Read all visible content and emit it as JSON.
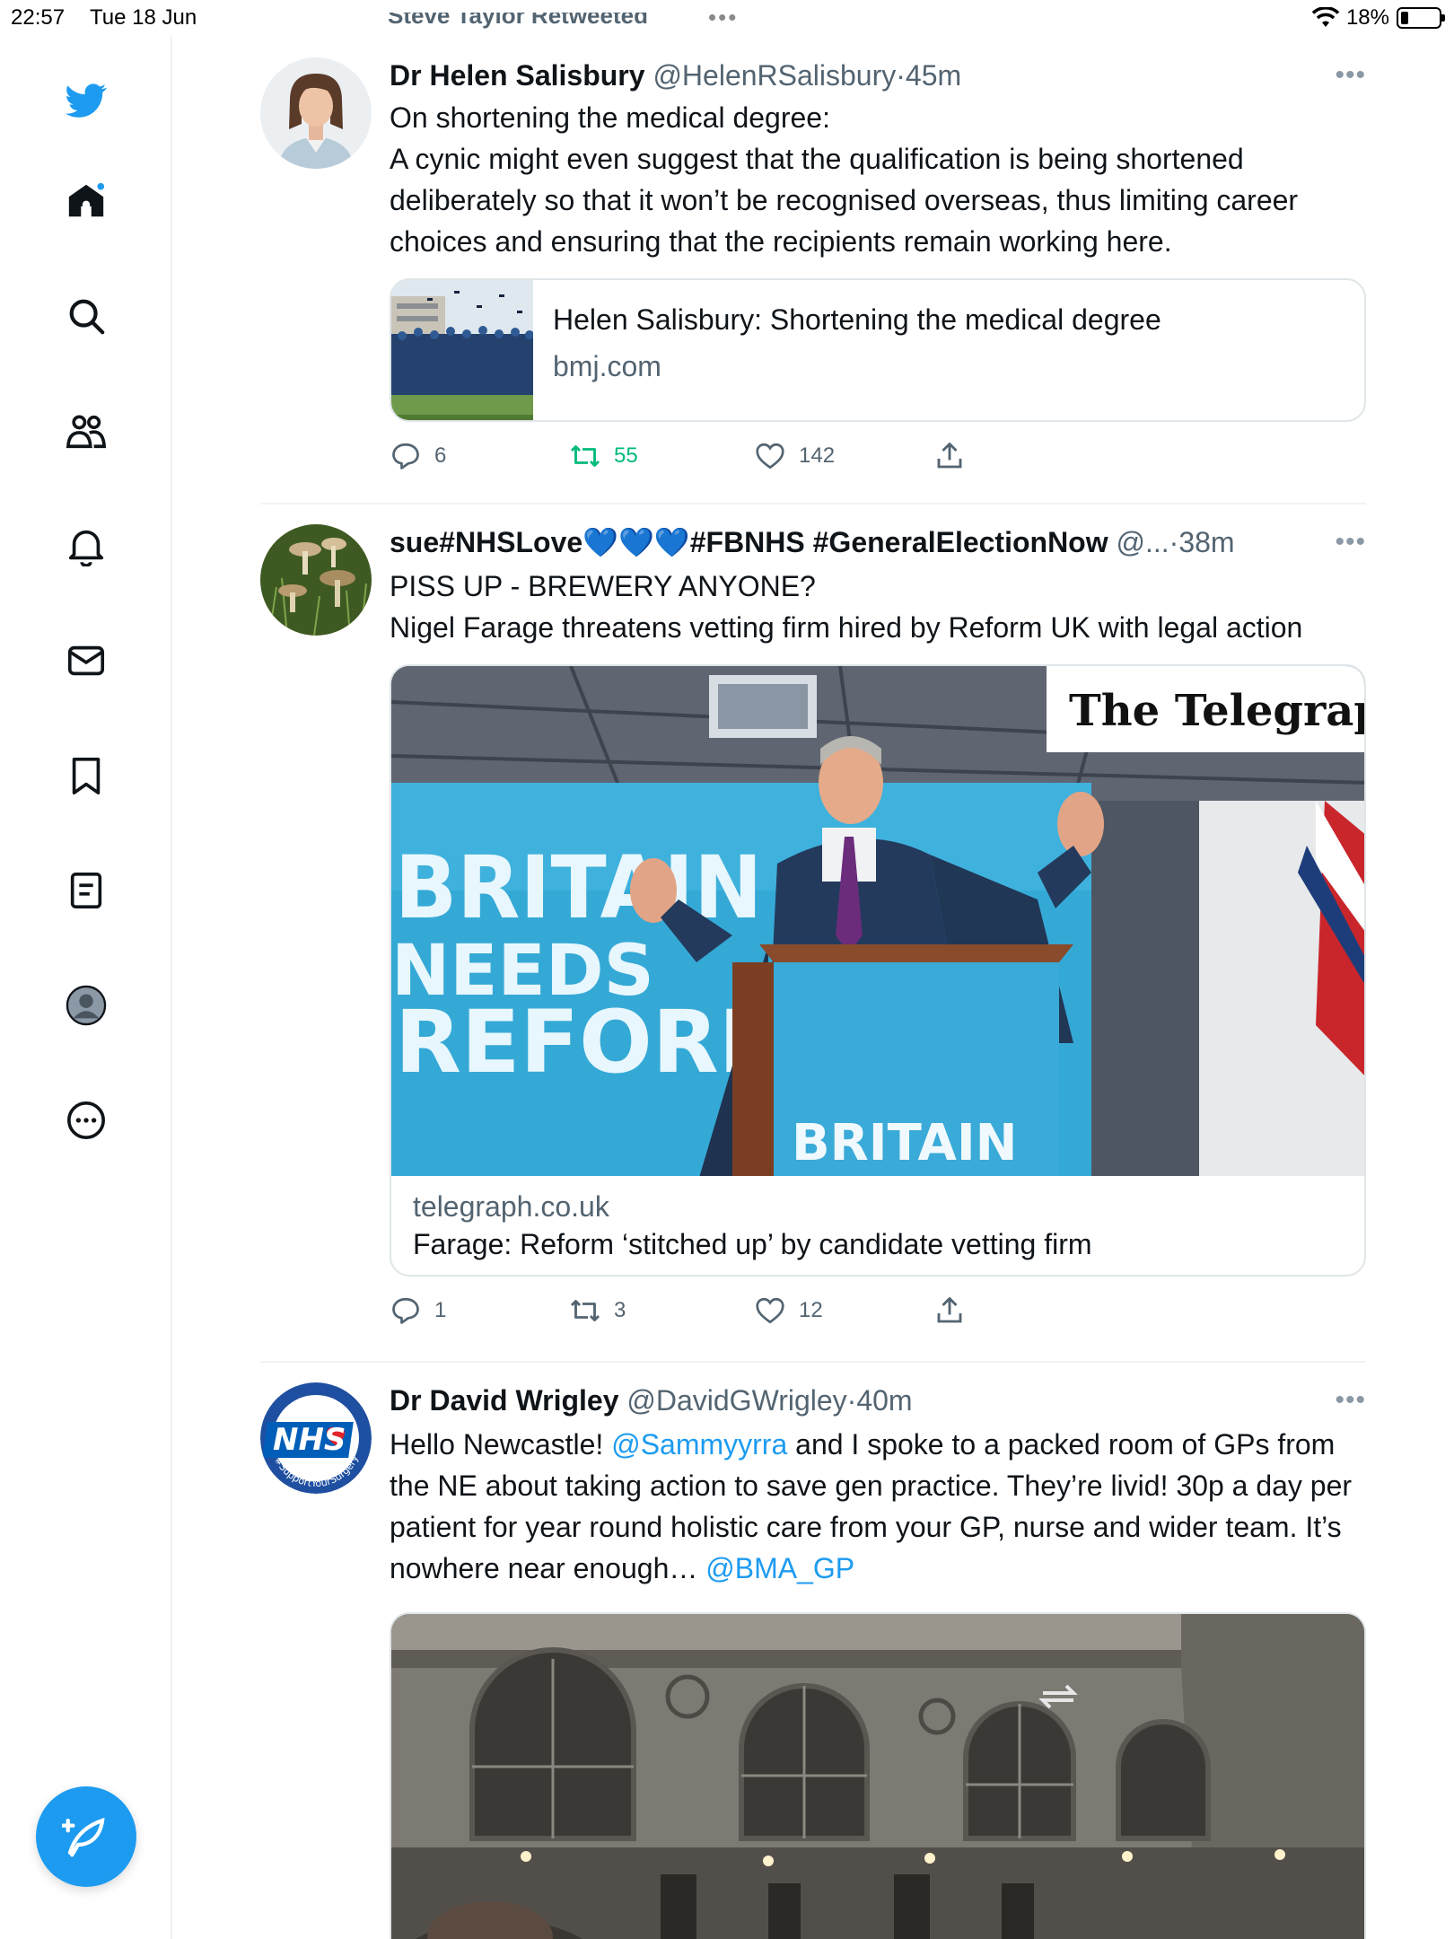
{
  "status_bar": {
    "time": "22:57",
    "date": "Tue 18 Jun",
    "multitask_dots": "•••",
    "battery": "18%"
  },
  "sidebar": {
    "items": [
      "twitter-logo",
      "home",
      "search",
      "communities",
      "notifications",
      "messages",
      "bookmarks",
      "lists",
      "profile",
      "more"
    ],
    "compose_label": "Compose"
  },
  "feed": {
    "partial_header": "Steve Taylor Retweeted",
    "tweets": [
      {
        "name": "Dr Helen Salisbury",
        "handle": "@HelenRSalisbury",
        "sep": "·",
        "ago": "45m",
        "text": "On shortening the medical degree:\nA cynic might even suggest that the qualification is being shortened deliberately so that it won’t be recognised overseas, thus limiting career choices and ensuring that the recipients remain working here.",
        "card": {
          "title": "Helen Salisbury: Shortening the medical degree",
          "domain": "bmj.com"
        },
        "replies": "6",
        "retweets": "55",
        "likes": "142"
      },
      {
        "name": "sue#NHSLove💙💙💙#FBNHS #GeneralElectionNow",
        "handle": "@...",
        "sep": "·",
        "ago": "38m",
        "text": "PISS UP - BREWERY ANYONE?\nNigel Farage threatens vetting firm hired by Reform UK with legal action",
        "card": {
          "masthead": "The Telegraph",
          "banner_line1": "BRITAIN",
          "banner_line2": "NEEDS",
          "banner_line3": "REFORM",
          "podium_text": "BRITAIN",
          "domain": "telegraph.co.uk",
          "title": "Farage: Reform ‘stitched up’ by candidate vetting firm"
        },
        "replies": "1",
        "retweets": "3",
        "likes": "12"
      },
      {
        "name": "Dr David Wrigley",
        "handle": "@DavidGWrigley",
        "sep": "·",
        "ago": "40m",
        "text_part1": "Hello Newcastle! ",
        "mention1": "@Sammyyrra",
        "text_part2": " and I spoke to a packed room of GPs from the NE about taking action to save gen practice. They’re livid! 30p a day per patient for year round holistic care from your GP, nurse and wider team. It’s nowhere near enough… ",
        "mention2": "@BMA_GP",
        "avatar_text": "NHS",
        "avatar_ring_text": "#SupportYourSurgery"
      }
    ]
  },
  "colors": {
    "accent": "#1d9bf0",
    "retweet_green": "#00ba7c",
    "muted": "#536471"
  }
}
